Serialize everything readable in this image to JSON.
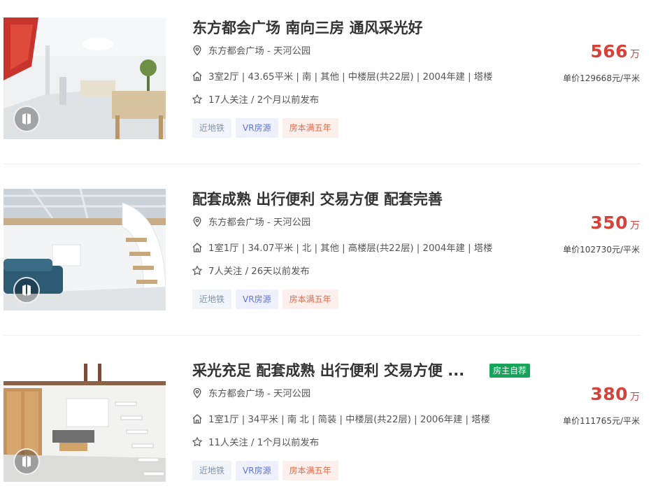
{
  "listings": [
    {
      "title": "东方都会广场 南向三房 通风采光好",
      "location": "东方都会广场 - 天河公园",
      "details": "3室2厅 | 43.65平米 | 南 | 其他 | 中楼层(共22层) | 2004年建 | 塔楼",
      "followers": "17人关注 / 2个月以前发布",
      "tags": [
        "近地铁",
        "VR房源",
        "房本满五年"
      ],
      "price": "566",
      "price_unit": "万",
      "unit_price": "单价129668元/平米",
      "owner_tag": ""
    },
    {
      "title": "配套成熟 出行便利 交易方便 配套完善",
      "location": "东方都会广场 - 天河公园",
      "details": "1室1厅 | 34.07平米 | 北 | 其他 | 高楼层(共22层) | 2004年建 | 塔楼",
      "followers": "7人关注 / 26天以前发布",
      "tags": [
        "近地铁",
        "VR房源",
        "房本满五年"
      ],
      "price": "350",
      "price_unit": "万",
      "unit_price": "单价102730元/平米",
      "owner_tag": ""
    },
    {
      "title": "采光充足 配套成熟 出行便利 交易方便 ...",
      "location": "东方都会广场 - 天河公园",
      "details": "1室1厅 | 34平米 | 南 北 | 简装 | 中楼层(共22层) | 2006年建 | 塔楼",
      "followers": "11人关注 / 1个月以前发布",
      "tags": [
        "近地铁",
        "VR房源",
        "房本满五年"
      ],
      "price": "380",
      "price_unit": "万",
      "unit_price": "单价111765元/平米",
      "owner_tag": "房主自荐"
    }
  ],
  "icons": {
    "location": "location-pin-icon",
    "house": "house-icon",
    "star": "star-icon",
    "vr": "vr-icon"
  },
  "colors": {
    "price": "#d6423a",
    "owner_tag_bg": "#16a35a",
    "tag_subway": "#7f93aa",
    "tag_vr": "#5b75d8",
    "tag_five": "#e36a4a"
  }
}
